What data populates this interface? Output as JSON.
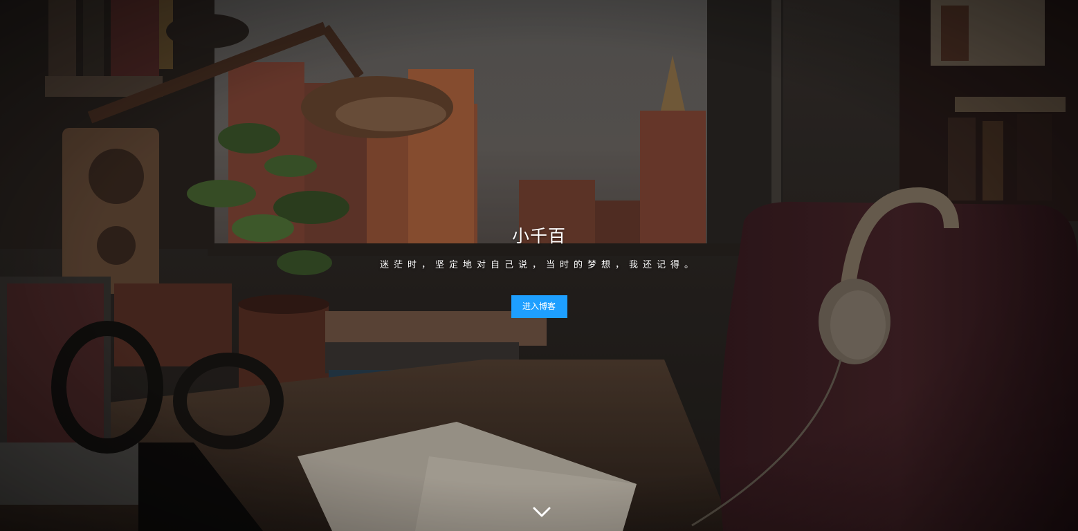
{
  "hero": {
    "title": "小千百",
    "motto": "迷茫时，坚定地对自己说，当时的梦想，我还记得。",
    "enter_button": "进入博客"
  },
  "icons": {
    "scroll_down": "chevron-down-icon"
  },
  "colors": {
    "button": "#1e9fff",
    "text": "#ffffff"
  }
}
